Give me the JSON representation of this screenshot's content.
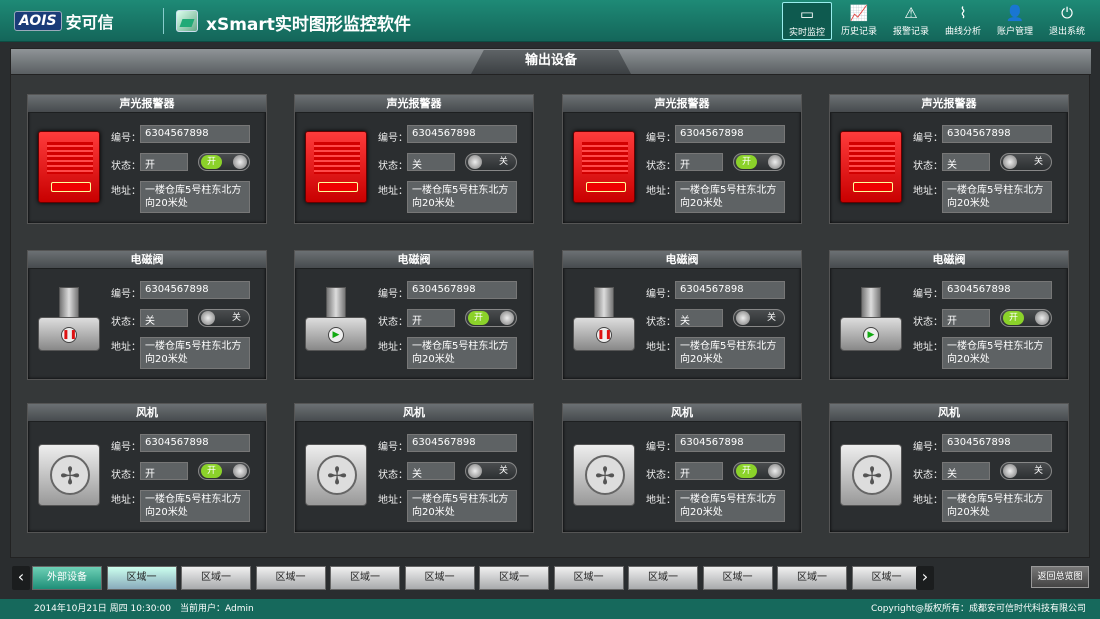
{
  "header": {
    "logo_mark": "AOIS",
    "logo_cn": "安可信",
    "app_title": "xSmart实时图形监控软件",
    "nav": [
      {
        "label": "实时监控",
        "icon": "monitor-icon",
        "active": true
      },
      {
        "label": "历史记录",
        "icon": "chart-line-icon"
      },
      {
        "label": "报警记录",
        "icon": "warning-icon"
      },
      {
        "label": "曲线分析",
        "icon": "curve-icon"
      },
      {
        "label": "账户管理",
        "icon": "user-icon"
      },
      {
        "label": "退出系统",
        "icon": "power-icon"
      }
    ]
  },
  "panel": {
    "title": "输出设备"
  },
  "labels": {
    "id": "编号：",
    "status": "状态：",
    "addr": "地址："
  },
  "cards": [
    {
      "title": "声光报警器",
      "type": "alarm",
      "id": "6304567898",
      "status": "开",
      "toggle": "开",
      "on": true,
      "addr": "一楼仓库5号柱东北方向20米处"
    },
    {
      "title": "声光报警器",
      "type": "alarm",
      "id": "6304567898",
      "status": "关",
      "toggle": "关",
      "on": false,
      "addr": "一楼仓库5号柱东北方向20米处"
    },
    {
      "title": "声光报警器",
      "type": "alarm",
      "id": "6304567898",
      "status": "开",
      "toggle": "开",
      "on": true,
      "addr": "一楼仓库5号柱东北方向20米处"
    },
    {
      "title": "声光报警器",
      "type": "alarm",
      "id": "6304567898",
      "status": "关",
      "toggle": "关",
      "on": false,
      "addr": "一楼仓库5号柱东北方向20米处"
    },
    {
      "title": "电磁阀",
      "type": "valve",
      "id": "6304567898",
      "status": "关",
      "toggle": "关",
      "on": false,
      "addr": "一楼仓库5号柱东北方向20米处"
    },
    {
      "title": "电磁阀",
      "type": "valve",
      "id": "6304567898",
      "status": "开",
      "toggle": "开",
      "on": true,
      "addr": "一楼仓库5号柱东北方向20米处"
    },
    {
      "title": "电磁阀",
      "type": "valve",
      "id": "6304567898",
      "status": "关",
      "toggle": "关",
      "on": false,
      "addr": "一楼仓库5号柱东北方向20米处"
    },
    {
      "title": "电磁阀",
      "type": "valve",
      "id": "6304567898",
      "status": "开",
      "toggle": "开",
      "on": true,
      "addr": "一楼仓库5号柱东北方向20米处"
    },
    {
      "title": "风机",
      "type": "fan",
      "id": "6304567898",
      "status": "开",
      "toggle": "开",
      "on": true,
      "addr": "一楼仓库5号柱东北方向20米处"
    },
    {
      "title": "风机",
      "type": "fan",
      "id": "6304567898",
      "status": "关",
      "toggle": "关",
      "on": false,
      "addr": "一楼仓库5号柱东北方向20米处"
    },
    {
      "title": "风机",
      "type": "fan",
      "id": "6304567898",
      "status": "开",
      "toggle": "开",
      "on": true,
      "addr": "一楼仓库5号柱东北方向20米处"
    },
    {
      "title": "风机",
      "type": "fan",
      "id": "6304567898",
      "status": "关",
      "toggle": "关",
      "on": false,
      "addr": "一楼仓库5号柱东北方向20米处"
    }
  ],
  "tabs": [
    "外部设备",
    "区域一",
    "区域一",
    "区域一",
    "区域一",
    "区域一",
    "区域一",
    "区域一",
    "区域一",
    "区域一",
    "区域一",
    "区域一"
  ],
  "back_label": "返回总览图",
  "footer": {
    "date": "2014年10月21日 周四  10:30:00",
    "user": "当前用户：Admin",
    "copyright": "Copyright@版权所有：成都安可信时代科技有限公司"
  }
}
